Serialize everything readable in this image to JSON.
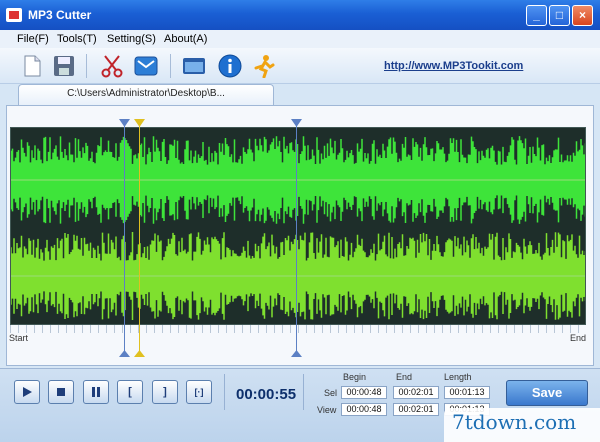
{
  "window": {
    "title": "MP3 Cutter",
    "min_glyph": "_",
    "max_glyph": "□",
    "close_glyph": "×"
  },
  "menu": [
    "File(F)",
    "Tools(T)",
    "Setting(S)",
    "About(A)"
  ],
  "toolbar": {
    "icons": [
      "new-file-icon",
      "save-icon",
      "cut-icon",
      "email-icon",
      "window-icon",
      "info-icon",
      "run-man-icon"
    ],
    "link": "http://www.MP3Tookit.com"
  },
  "tab": {
    "label": "C:\\Users\\Administrator\\Desktop\\B..."
  },
  "waveform": {
    "colors": {
      "background": "#1e2e2a",
      "upper": "#3ee43a",
      "lower": "#7fe02f"
    },
    "start_label": "Start",
    "end_label": "End"
  },
  "controls": {
    "time": "00:00:55",
    "buttons": [
      "play-icon",
      "stop-icon",
      "pause-icon",
      "set-begin-icon",
      "set-end-icon",
      "play-selection-icon"
    ],
    "begin_glyph": "[",
    "end_glyph": "]",
    "sel_glyph": "[·]"
  },
  "ranges": {
    "headers": {
      "begin": "Begin",
      "end": "End",
      "length": "Length"
    },
    "sel": {
      "label": "Sel",
      "begin": "00:00:48",
      "end": "00:02:01",
      "length": "00:01:13"
    },
    "view": {
      "label": "View",
      "begin": "00:00:48",
      "end": "00:02:01",
      "length": "00:01:13"
    }
  },
  "save_label": "Save",
  "watermark": "7tdown.com"
}
